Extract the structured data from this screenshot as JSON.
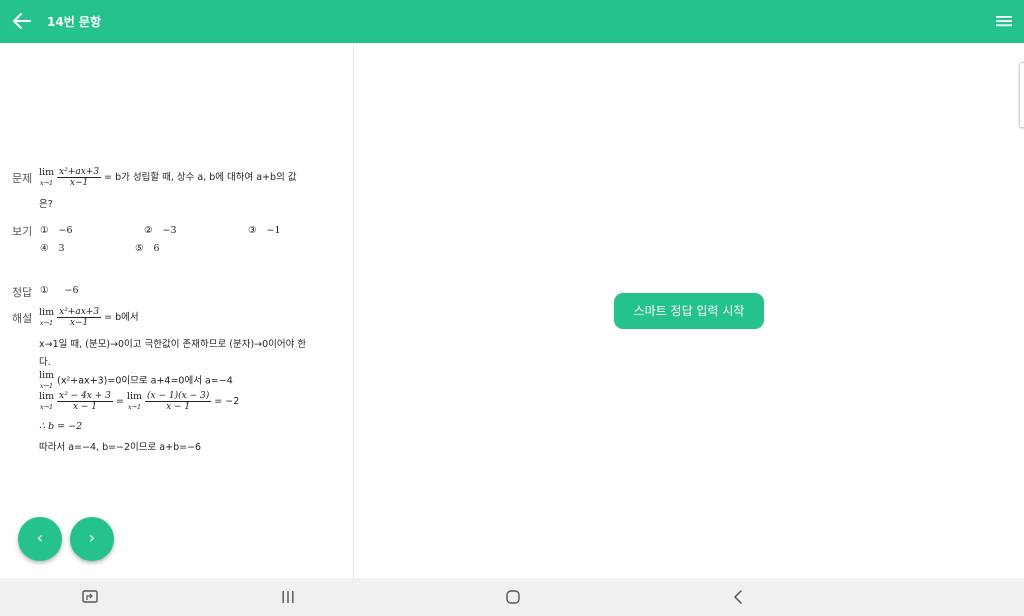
{
  "colors": {
    "accent": "#26c28e"
  },
  "header": {
    "title": "14번 문항",
    "back_icon": "arrow-left-icon",
    "menu_icon": "hamburger-menu-icon"
  },
  "question": {
    "label": "문제",
    "lim_word": "lim",
    "lim_sub": "x→1",
    "frac_num": "x²+ax+3",
    "frac_den": "x−1",
    "text_a": "= b가 성립할 때, 상수 a, b에 대하여 a+b의 값",
    "text_b": "은?"
  },
  "choices": {
    "label": "보기",
    "items": [
      {
        "num": "①",
        "value": "−6"
      },
      {
        "num": "②",
        "value": "−3"
      },
      {
        "num": "③",
        "value": "−1"
      },
      {
        "num": "④",
        "value": "3"
      },
      {
        "num": "⑤",
        "value": "6"
      }
    ]
  },
  "answer": {
    "label": "정답",
    "num": "①",
    "value": "−6"
  },
  "solution": {
    "label": "해설",
    "line1_tail": "= b에서",
    "line2": "x→1일 때, (분모)→0이고 극한값이 존재하므로 (분자)→0이어야 한",
    "line3": "다.",
    "line4_expr": "(x²+ax+3)=0이므로 a+4=0에서 a=−4",
    "line5_num1": "x² − 4x + 3",
    "line5_den1": "x − 1",
    "line5_num2": "(x − 1)(x − 3)",
    "line5_den2": "x − 1",
    "line5_mid": "=",
    "line5_tail": "= −2",
    "line6": "∴ b = −2",
    "line7": "따라서 a=−4,  b=−2이므로 a+b=−6"
  },
  "nav": {
    "prev_label": "‹",
    "next_label": "›"
  },
  "smart_button": {
    "label": "스마트 정답 입력 시작"
  },
  "system_bar": {
    "icons": [
      "screenshot-icon",
      "recent-apps-icon",
      "home-icon",
      "back-nav-icon"
    ]
  }
}
